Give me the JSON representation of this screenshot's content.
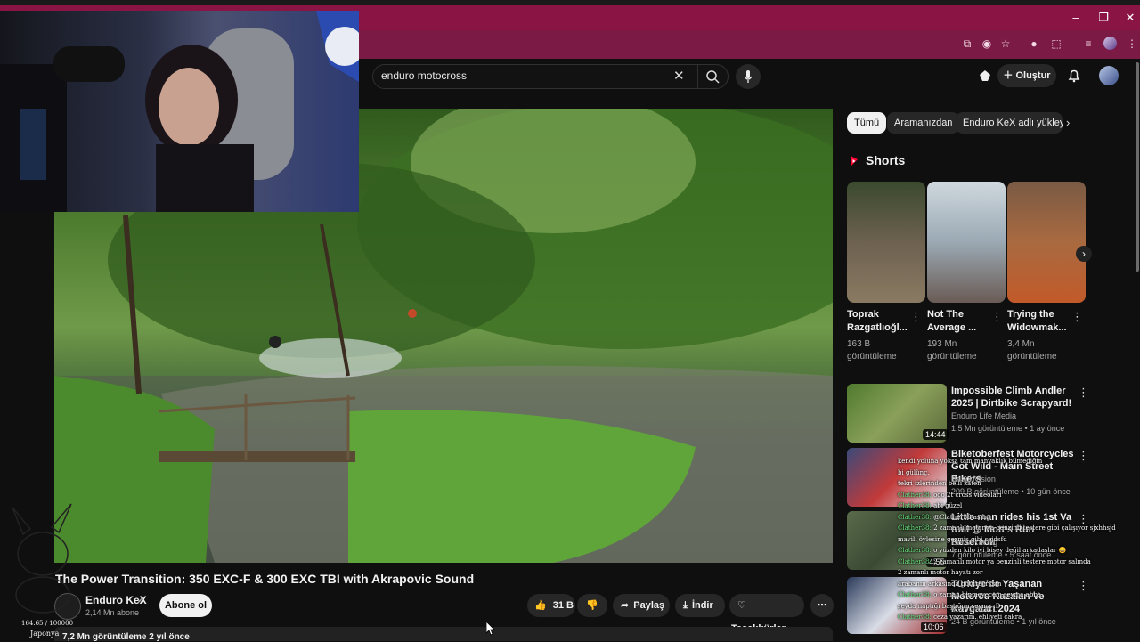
{
  "browser": {
    "window_controls": [
      "–",
      "❐",
      "✕"
    ]
  },
  "youtube": {
    "search": {
      "value": "enduro motocross"
    },
    "create_label": "Oluştur"
  },
  "video": {
    "title": "The Power Transition: 350 EXC-F & 300 EXC TBI with Akrapovic Sound",
    "channel": "Enduro KeX",
    "subscribers": "2,14 Mn abone",
    "subscribe_label": "Abone ol",
    "likes": "31 B",
    "share_label": "Paylaş",
    "download_label": "İndir",
    "thanks_label": "Teşekkürler",
    "views_date": "7,2 Mn görüntüleme  2 yıl önce"
  },
  "filters": [
    "Tümü",
    "Aramanızdan",
    "Enduro KeX adlı yükleyic"
  ],
  "shorts": {
    "heading": "Shorts",
    "items": [
      {
        "title": "Toprak Razgatlıoğl...",
        "views": "163 B görüntüleme"
      },
      {
        "title": "Not The Average ...",
        "views": "193 Mn görüntüleme"
      },
      {
        "title": "Trying the Widowmak...",
        "views": "3,4 Mn görüntüleme"
      }
    ]
  },
  "recommendations": [
    {
      "title": "Impossible Climb Andler 2025 | Dirtbike Scrapyard!",
      "channel": "Enduro Life Media",
      "meta": "1,5 Mn görüntüleme • 1 ay önce",
      "duration": "14:44"
    },
    {
      "title": "Biketoberfest Motorcycles Got Wild - Main Street Bikers",
      "channel": "BeachVision",
      "meta": "209 B görüntüleme • 10 gün önce",
      "duration": ""
    },
    {
      "title": "Little man rides his 1st Va trail @ Mott's Run Reservoir",
      "channel": "Cobb Racing",
      "meta": "7 görüntüleme • 5 saat önce",
      "duration": "4:55"
    },
    {
      "title": "Türkiye'de Yaşanan Motorcu Kazaları Ve Kavgaları 2024",
      "channel": "MOTOKOCU",
      "meta": "24 B görüntüleme • 1 yıl önce",
      "duration": "10:06"
    }
  ],
  "overlay": {
    "counter": "164.65 / 100000",
    "location": "Japonya",
    "chat": [
      {
        "user": "",
        "text": "kendi yoluna yoksa tam manyaklık bilmediğin"
      },
      {
        "user": "",
        "text": "bi gülünç."
      },
      {
        "user": "",
        "text": "tekri izlerinden belli zaten"
      },
      {
        "user": "Clather38",
        "text": "ooo 2t cross videoları"
      },
      {
        "user": "Clather38",
        "text": "abi güzel"
      },
      {
        "user": "Clather38",
        "text": "@Clather38 as hg"
      },
      {
        "user": "Clather38",
        "text": "2 zamanlı motor ya benzinli testere gibi çalışıyor sjxhhsjd"
      },
      {
        "user": "",
        "text": "mavili öylesine gezmiş gibi sejdsfd"
      },
      {
        "user": "Clather38",
        "text": "o yüzden kilo iyi bişey değil arkadaşlar 😄"
      },
      {
        "user": "Clather38",
        "text": "2 zamanlı motor ya benzinli testere motor salında"
      },
      {
        "user": "",
        "text": "2 zamanlı motor hayatı zor"
      },
      {
        "user": "",
        "text": "arabanın arkasında götürecrksin"
      },
      {
        "user": "Clather38",
        "text": "o zaman binmeyecem şeyma abba"
      },
      {
        "user": "",
        "text": "şeyda naptığı baştığım şeyma :D"
      },
      {
        "user": "Clather38",
        "text": "ceza yazarım. ehliyeti çakra"
      }
    ]
  }
}
